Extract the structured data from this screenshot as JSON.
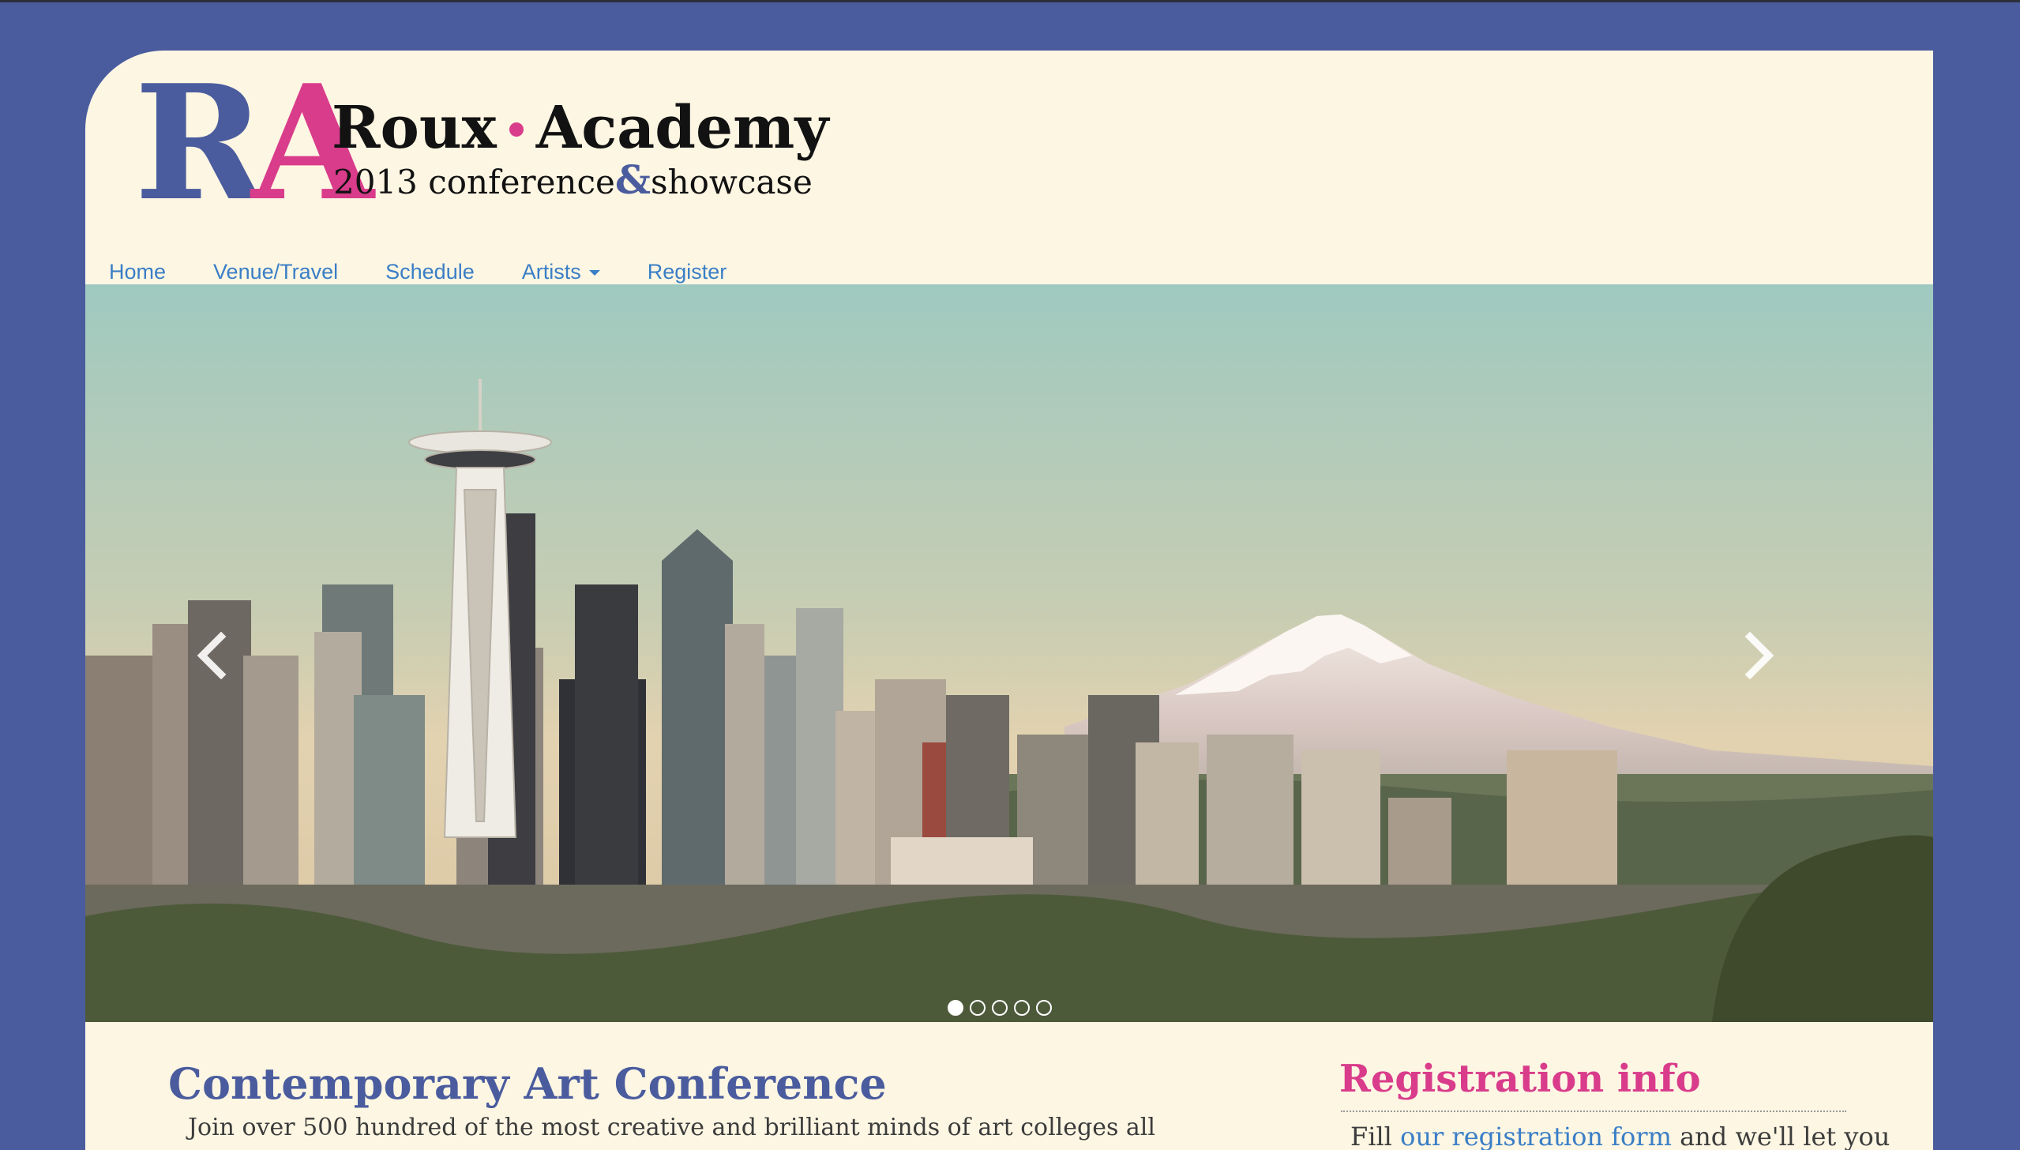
{
  "logo": {
    "mark_r": "R",
    "mark_a": "A",
    "name_left": "Roux",
    "name_right": "Academy",
    "sub_left": "2013 conference",
    "sub_amp": "&",
    "sub_right": "showcase"
  },
  "nav": {
    "home": "Home",
    "venue": "Venue/Travel",
    "schedule": "Schedule",
    "artists": "Artists",
    "register": "Register"
  },
  "carousel": {
    "slide_count": 5,
    "active_index": 0,
    "left_icon": "chevron-left-icon",
    "right_icon": "chevron-right-icon"
  },
  "main": {
    "title": "Contemporary Art Conference",
    "text": "Join over 500 hundred of the most creative and brilliant minds of art colleges all"
  },
  "sidebar": {
    "title": "Registration info",
    "text_before": "Fill ",
    "link": "our registration form",
    "text_after": " and we'll let you"
  },
  "colors": {
    "background": "#4a5c9e",
    "page": "#fdf6e3",
    "accent_pink": "#d93c8b",
    "accent_blue": "#4a5c9e",
    "link": "#3a7ec6"
  }
}
